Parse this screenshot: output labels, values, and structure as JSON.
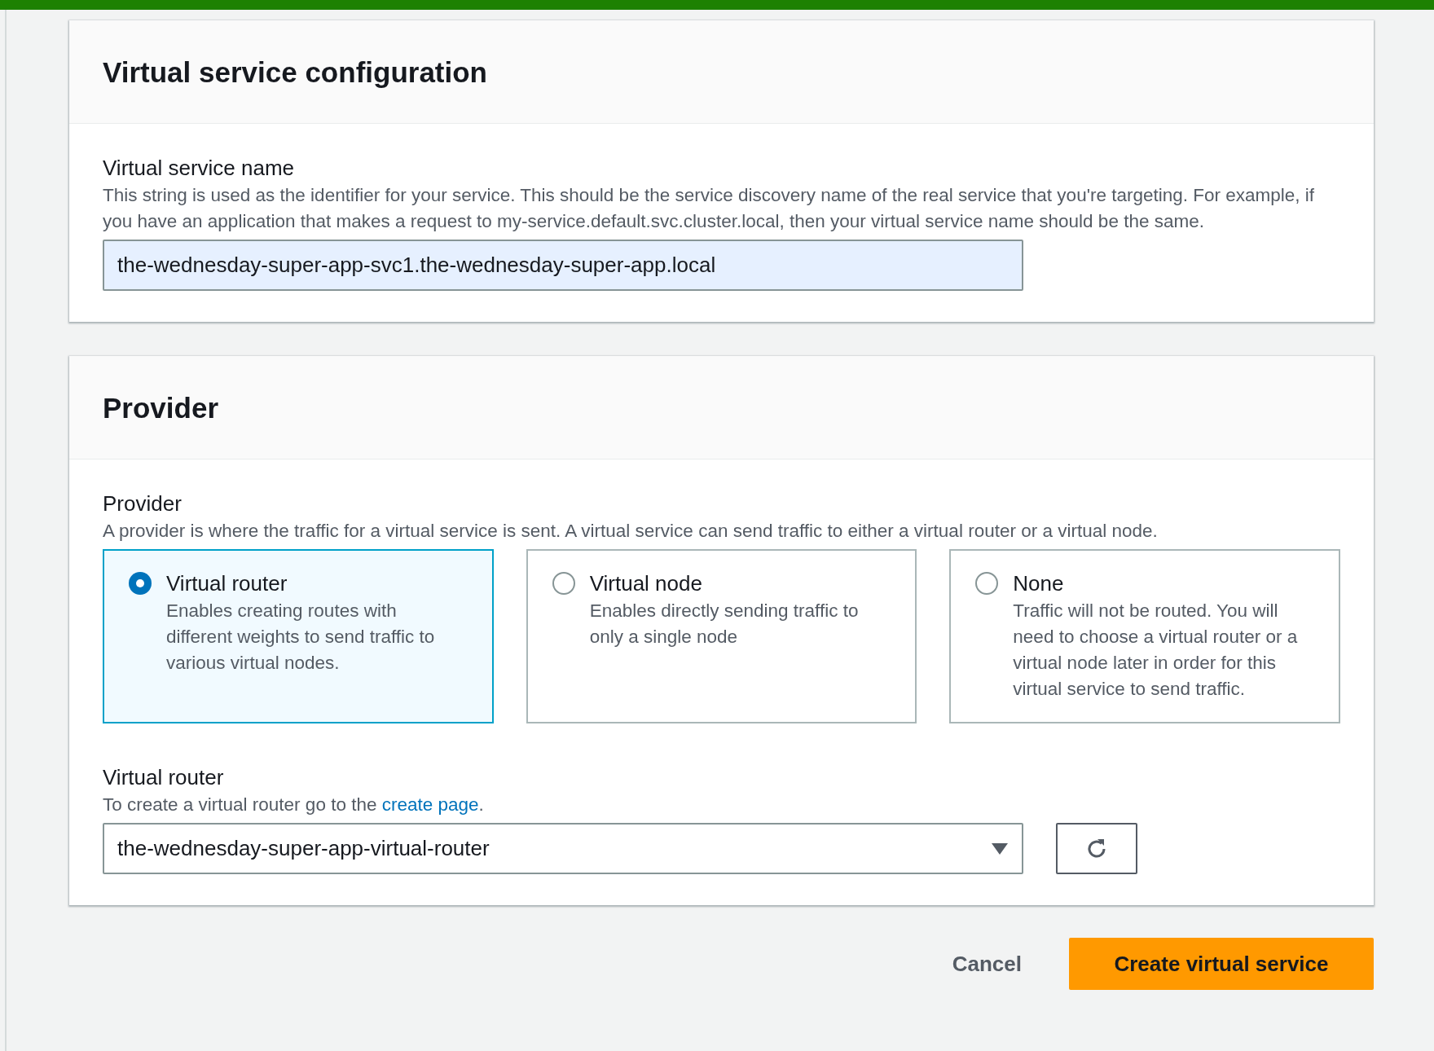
{
  "sections": [
    {
      "title": "Virtual service configuration",
      "fields": [
        {
          "kind": "text",
          "label": "Virtual service name",
          "description": "This string is used as the identifier for your service. This should be the service discovery name of the real service that you're targeting. For example, if you have an application that makes a request to my-service.default.svc.cluster.local, then your virtual service name should be the same.",
          "value": "the-wednesday-super-app-svc1.the-wednesday-super-app.local"
        }
      ]
    },
    {
      "title": "Provider",
      "fields": [
        {
          "kind": "tiles",
          "label": "Provider",
          "description": "A provider is where the traffic for a virtual service is sent. A virtual service can send traffic to either a virtual router or a virtual node.",
          "options": [
            {
              "label": "Virtual router",
              "description": "Enables creating routes with different weights to send traffic to various virtual nodes.",
              "selected": true
            },
            {
              "label": "Virtual node",
              "description": "Enables directly sending traffic to only a single node",
              "selected": false
            },
            {
              "label": "None",
              "description": "Traffic will not be routed. You will need to choose a virtual router or a virtual node later in order for this virtual service to send traffic.",
              "selected": false
            }
          ]
        },
        {
          "kind": "select",
          "label": "Virtual router",
          "description": "To create a virtual router go to the ",
          "link": "create page",
          "description_end": ".",
          "value": "the-wednesday-super-app-virtual-router"
        }
      ]
    }
  ],
  "actions": {
    "cancel": "Cancel",
    "primary": "Create virtual service"
  }
}
